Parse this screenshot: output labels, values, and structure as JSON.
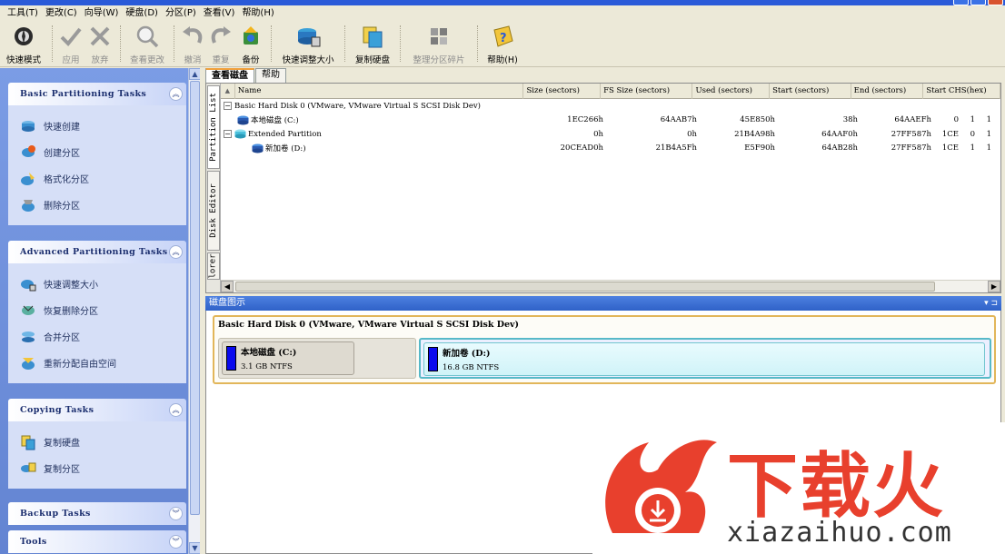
{
  "menu": [
    "工具(T)",
    "更改(C)",
    "向导(W)",
    "硬盘(D)",
    "分区(P)",
    "查看(V)",
    "帮助(H)"
  ],
  "toolbar": {
    "quick_mode": "快速模式",
    "apply": "应用",
    "discard": "放弃",
    "view_changes": "查看更改",
    "undo": "撤消",
    "redo": "重复",
    "backup": "备份",
    "quick_resize": "快速调整大小",
    "copy_disk": "复制硬盘",
    "defrag": "整理分区碎片",
    "help": "帮助(H)"
  },
  "tasks": {
    "basic": {
      "title": "Basic Partitioning Tasks",
      "items": [
        "快速创建",
        "创建分区",
        "格式化分区",
        "删除分区"
      ]
    },
    "advanced": {
      "title": "Advanced Partitioning Tasks",
      "items": [
        "快速调整大小",
        "恢复删除分区",
        "合并分区",
        "重新分配自由空间"
      ]
    },
    "copying": {
      "title": "Copying Tasks",
      "items": [
        "复制硬盘",
        "复制分区"
      ]
    },
    "backup": {
      "title": "Backup Tasks"
    },
    "tools": {
      "title": "Tools"
    }
  },
  "tabs": {
    "view_disk": "查看磁盘",
    "help": "帮助"
  },
  "side_tabs": {
    "partition_list": "Partition List",
    "disk_editor": "Disk Editor",
    "explorer": "lorer"
  },
  "columns": {
    "name": "Name",
    "size": "Size (sectors)",
    "fs_size": "FS Size (sectors)",
    "used": "Used (sectors)",
    "start": "Start (sectors)",
    "end": "End (sectors)",
    "start_chs": "Start CHS(hex)"
  },
  "rows": [
    {
      "name": "Basic Hard Disk 0 (VMware, VMware Virtual S SCSI Disk Dev)",
      "size": "",
      "fs_size": "",
      "used": "",
      "start": "",
      "end": "",
      "chs": [
        "",
        "",
        ""
      ]
    },
    {
      "name": "本地磁盘 (C:)",
      "size": "1EC266h",
      "fs_size": "64AAB7h",
      "used": "45E850h",
      "start": "38h",
      "end": "64AAEFh",
      "chs": [
        "0",
        "1",
        "1"
      ]
    },
    {
      "name": "Extended Partition",
      "size": "0h",
      "fs_size": "0h",
      "used": "21B4A98h",
      "start": "64AAF0h",
      "end": "27FF587h",
      "chs": [
        "1CE",
        "0",
        "1"
      ]
    },
    {
      "name": "新加卷 (D:)",
      "size": "20CEAD0h",
      "fs_size": "21B4A5Fh",
      "used": "E5F90h",
      "start": "64AB28h",
      "end": "27FF587h",
      "chs": [
        "1CE",
        "1",
        "1"
      ]
    }
  ],
  "disk_map": {
    "header": "磁盘图示",
    "disk_title": "Basic Hard Disk 0 (VMware, VMware Virtual S SCSI Disk Dev)",
    "partitions": [
      {
        "name": "本地磁盘 (C:)",
        "info": "3.1 GB NTFS"
      },
      {
        "name": "新加卷 (D:)",
        "info": "16.8 GB NTFS"
      }
    ]
  },
  "watermark": {
    "brand": "下载火",
    "url": "xiazaihuo.com"
  },
  "colors": {
    "accent_blue": "#2f62c8",
    "partition_bar": "#0a0aee",
    "brand_red": "#e8402d",
    "selected_outline": "#57b9c8"
  }
}
